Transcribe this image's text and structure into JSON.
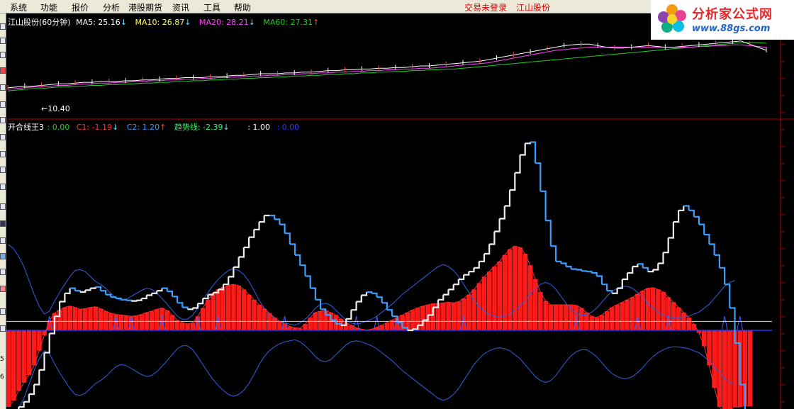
{
  "menu": [
    "系统",
    "功能",
    "报价",
    "分析",
    "港股期货",
    "资讯",
    "工具",
    "帮助"
  ],
  "status": {
    "login": "交易未登录",
    "stock": "江山股份"
  },
  "logo": {
    "brand": "分析家公式网",
    "url": "www.88gs.com"
  },
  "colors": {
    "ma5": "#ffffff",
    "ma10": "#ffff66",
    "ma20": "#ff44ff",
    "ma60": "#22cc22",
    "c1": "#ff2222",
    "c2": "#2f9bff",
    "trend": "#22ff66",
    "blue": "#2244ff",
    "thin_blue": "#3060e0"
  },
  "price_panel": {
    "title": "江山股份(60分钟)",
    "ma": [
      {
        "label": "MA5: 25.16",
        "arrow": "↓",
        "arrow_color": "#66ddff"
      },
      {
        "label": "MA10: 26.87",
        "arrow": "↓",
        "arrow_color": "#66ddff"
      },
      {
        "label": "MA20: 28.21",
        "arrow": "↓",
        "arrow_color": "#66ddff"
      },
      {
        "label": "MA60: 27.31",
        "arrow": "↑",
        "arrow_color": "#ff4444"
      }
    ],
    "low_label": "←10.40"
  },
  "indicator_panel": {
    "title": "开合线王3",
    "items": [
      {
        "label": ": 0.00",
        "arrow": ""
      },
      {
        "label": "C1: -1.19",
        "arrow": "↓"
      },
      {
        "label": "C2: 1.20",
        "arrow": "↑"
      },
      {
        "label": "趋势线: -2.39",
        "arrow": "↓"
      },
      {
        "label": ": 1.00",
        "arrow": ""
      },
      {
        "label": ": 0.00",
        "arrow": ""
      }
    ]
  },
  "left_axis": [
    "5",
    "6"
  ],
  "chart_data": {
    "type": "line",
    "trend_line": [
      -1.35,
      -1.28,
      -1.2,
      -1.12,
      -1.0,
      -0.85,
      -0.62,
      -0.35,
      -0.05,
      0.22,
      0.45,
      0.58,
      0.66,
      0.62,
      0.6,
      0.63,
      0.66,
      0.68,
      0.62,
      0.56,
      0.52,
      0.5,
      0.48,
      0.47,
      0.46,
      0.47,
      0.5,
      0.55,
      0.58,
      0.62,
      0.66,
      0.61,
      0.53,
      0.43,
      0.36,
      0.33,
      0.35,
      0.42,
      0.5,
      0.56,
      0.59,
      0.64,
      0.72,
      0.84,
      0.99,
      1.15,
      1.3,
      1.46,
      1.58,
      1.7,
      1.8,
      1.8,
      1.74,
      1.66,
      1.52,
      1.35,
      1.18,
      1.02,
      0.85,
      0.66,
      0.48,
      0.33,
      0.24,
      0.16,
      0.1,
      0.08,
      0.18,
      0.32,
      0.45,
      0.55,
      0.6,
      0.58,
      0.52,
      0.43,
      0.32,
      0.22,
      0.12,
      0.04,
      0.0,
      0.02,
      0.08,
      0.16,
      0.24,
      0.36,
      0.48,
      0.56,
      0.64,
      0.72,
      0.8,
      0.87,
      0.92,
      0.98,
      1.08,
      1.2,
      1.35,
      1.55,
      1.75,
      1.95,
      2.2,
      2.47,
      2.75,
      2.93,
      2.95,
      2.62,
      2.18,
      1.72,
      1.32,
      1.08,
      1.05,
      1.0,
      0.96,
      0.95,
      0.93,
      0.92,
      0.9,
      0.85,
      0.72,
      0.62,
      0.58,
      0.66,
      0.8,
      0.9,
      1.0,
      1.04,
      0.98,
      0.92,
      0.95,
      1.05,
      1.22,
      1.45,
      1.7,
      1.88,
      1.95,
      1.88,
      1.78,
      1.66,
      1.5,
      1.35,
      1.18,
      0.98,
      0.72,
      0.35,
      -0.2,
      -0.85,
      -1.35,
      -1.52,
      -1.5,
      -1.48,
      -1.45,
      -1.45
    ],
    "c1_histogram": [
      -1.2,
      -1.1,
      -0.95,
      -0.82,
      -0.7,
      -0.55,
      -0.32,
      -0.08,
      0.15,
      0.27,
      0.32,
      0.36,
      0.38,
      0.36,
      0.33,
      0.34,
      0.36,
      0.37,
      0.34,
      0.3,
      0.27,
      0.25,
      0.24,
      0.23,
      0.22,
      0.23,
      0.25,
      0.28,
      0.3,
      0.33,
      0.35,
      0.31,
      0.24,
      0.16,
      0.12,
      0.1,
      0.12,
      0.22,
      0.35,
      0.48,
      0.58,
      0.64,
      0.68,
      0.7,
      0.72,
      0.7,
      0.64,
      0.56,
      0.48,
      0.4,
      0.34,
      0.27,
      0.2,
      0.14,
      0.1,
      0.06,
      0.04,
      0.03,
      0.1,
      0.2,
      0.28,
      0.3,
      0.31,
      0.28,
      0.24,
      0.18,
      0.12,
      0.08,
      0.04,
      0.02,
      0.0,
      0.02,
      0.05,
      0.08,
      0.12,
      0.16,
      0.2,
      0.24,
      0.28,
      0.32,
      0.35,
      0.38,
      0.4,
      0.42,
      0.42,
      0.43,
      0.44,
      0.43,
      0.45,
      0.5,
      0.56,
      0.64,
      0.74,
      0.84,
      0.92,
      1.0,
      1.08,
      1.18,
      1.27,
      1.32,
      1.3,
      1.2,
      1.02,
      0.8,
      0.6,
      0.46,
      0.4,
      0.4,
      0.4,
      0.4,
      0.4,
      0.39,
      0.35,
      0.28,
      0.22,
      0.2,
      0.24,
      0.3,
      0.36,
      0.4,
      0.44,
      0.48,
      0.52,
      0.57,
      0.62,
      0.66,
      0.67,
      0.64,
      0.6,
      0.52,
      0.44,
      0.36,
      0.28,
      0.2,
      0.1,
      -0.04,
      -0.25,
      -0.55,
      -0.9,
      -1.2,
      -1.3,
      -1.25,
      -1.2,
      -1.2,
      -1.18,
      -1.19
    ],
    "c1_line": [
      -1.2,
      -1.1,
      -0.95,
      -0.82,
      -0.7,
      -0.55,
      -0.32,
      -0.08,
      0.15,
      0.27,
      0.32,
      0.36,
      0.38,
      0.36,
      0.33,
      0.34,
      0.36,
      0.37,
      0.34,
      0.3,
      0.27,
      0.25,
      0.24,
      0.23,
      0.22,
      0.23,
      0.25,
      0.28,
      0.3,
      0.33,
      0.35,
      0.31,
      0.24,
      0.16,
      0.12,
      0.1,
      0.12,
      0.22,
      0.35,
      0.48,
      0.58,
      0.64,
      0.68,
      0.7,
      0.72,
      0.7,
      0.64,
      0.56,
      0.48,
      0.4,
      0.34,
      0.27,
      0.2,
      0.14,
      0.1,
      0.06,
      0.04,
      0.03,
      0.1,
      0.2,
      0.28,
      0.3,
      0.31,
      0.28,
      0.24,
      0.18,
      0.12,
      0.08,
      0.04,
      0.02,
      0.0,
      0.02,
      0.05,
      0.08,
      0.12,
      0.16,
      0.2,
      0.24,
      0.28,
      0.32,
      0.35,
      0.38,
      0.4,
      0.42,
      0.42,
      0.43,
      0.44,
      0.43,
      0.45,
      0.5,
      0.56,
      0.64,
      0.74,
      0.84,
      0.92,
      1.0,
      1.08,
      1.18,
      1.27,
      1.32,
      1.3,
      1.2,
      1.02,
      0.8,
      0.6,
      0.46,
      0.4,
      0.4,
      0.4,
      0.4,
      0.4,
      0.39,
      0.35,
      0.28,
      0.22,
      0.2,
      0.24,
      0.3,
      0.36,
      0.4,
      0.44,
      0.48,
      0.52,
      0.57,
      0.62,
      0.66,
      0.67,
      0.64,
      0.6,
      0.52,
      0.44,
      0.36,
      0.28,
      0.2,
      0.1,
      -0.04,
      -0.25,
      -0.55,
      -0.9,
      -1.2,
      -1.3,
      -1.25,
      -1.2,
      -1.2,
      -1.18,
      -1.19
    ],
    "blue_upper": [
      0.82,
      0.78,
      0.7,
      0.6,
      0.46,
      0.32,
      0.2,
      0.12,
      0.15,
      0.25,
      0.34,
      0.42,
      0.5,
      0.56,
      0.57,
      0.55,
      0.5,
      0.45,
      0.42,
      0.38,
      0.33,
      0.28,
      0.26,
      0.27,
      0.3,
      0.33,
      0.36,
      0.38,
      0.37,
      0.33,
      0.28,
      0.22,
      0.16,
      0.1,
      0.07,
      0.07,
      0.11,
      0.18,
      0.26,
      0.34,
      0.41,
      0.47,
      0.52,
      0.56,
      0.58,
      0.56,
      0.52,
      0.45,
      0.36,
      0.26,
      0.18,
      0.12,
      0.08,
      0.05,
      0.03,
      0.02,
      0.01,
      0.03,
      0.07,
      0.12,
      0.18,
      0.22,
      0.23,
      0.21,
      0.16,
      0.11,
      0.06,
      0.03,
      0.02,
      0.03,
      0.05,
      0.07,
      0.1,
      0.14,
      0.18,
      0.22,
      0.27,
      0.32,
      0.36,
      0.4,
      0.44,
      0.48,
      0.52,
      0.56,
      0.6,
      0.62,
      0.6,
      0.56,
      0.5,
      0.42,
      0.34,
      0.26,
      0.2,
      0.15,
      0.12,
      0.1,
      0.09,
      0.1,
      0.12,
      0.16,
      0.2,
      0.26,
      0.32,
      0.38,
      0.42,
      0.44,
      0.42,
      0.37,
      0.3,
      0.23,
      0.17,
      0.13,
      0.11,
      0.11,
      0.14,
      0.18,
      0.24,
      0.3,
      0.35,
      0.38,
      0.4,
      0.4,
      0.38,
      0.34,
      0.29,
      0.23,
      0.18,
      0.14,
      0.11,
      0.09,
      0.08,
      0.08,
      0.09,
      0.1,
      0.12,
      0.14,
      0.18,
      0.22,
      0.28,
      0.34,
      0.4,
      0.44,
      0.46
    ],
    "blue_lower": [
      -0.82,
      -0.78,
      -0.7,
      -0.6,
      -0.46,
      -0.32,
      -0.2,
      -0.12,
      -0.15,
      -0.25,
      -0.34,
      -0.42,
      -0.5,
      -0.56,
      -0.57,
      -0.55,
      -0.5,
      -0.45,
      -0.42,
      -0.38,
      -0.33,
      -0.28,
      -0.26,
      -0.27,
      -0.3,
      -0.33,
      -0.36,
      -0.38,
      -0.37,
      -0.33,
      -0.28,
      -0.22,
      -0.16,
      -0.1,
      -0.07,
      -0.07,
      -0.11,
      -0.18,
      -0.26,
      -0.34,
      -0.41,
      -0.47,
      -0.52,
      -0.56,
      -0.58,
      -0.56,
      -0.52,
      -0.45,
      -0.36,
      -0.26,
      -0.18,
      -0.12,
      -0.08,
      -0.05,
      -0.03,
      -0.02,
      -0.01,
      -0.03,
      -0.07,
      -0.12,
      -0.18,
      -0.22,
      -0.23,
      -0.21,
      -0.16,
      -0.11,
      -0.06,
      -0.03,
      -0.02,
      -0.03,
      -0.05,
      -0.07,
      -0.1,
      -0.14,
      -0.18,
      -0.22,
      -0.27,
      -0.32,
      -0.36,
      -0.4,
      -0.44,
      -0.48,
      -0.52,
      -0.56,
      -0.6,
      -0.62,
      -0.6,
      -0.56,
      -0.5,
      -0.42,
      -0.34,
      -0.26,
      -0.2,
      -0.15,
      -0.12,
      -0.1,
      -0.09,
      -0.1,
      -0.12,
      -0.16,
      -0.2,
      -0.26,
      -0.32,
      -0.38,
      -0.42,
      -0.44,
      -0.42,
      -0.37,
      -0.3,
      -0.23,
      -0.17,
      -0.13,
      -0.11,
      -0.11,
      -0.14,
      -0.18,
      -0.24,
      -0.3,
      -0.35,
      -0.38,
      -0.4,
      -0.4,
      -0.38,
      -0.34,
      -0.29,
      -0.23,
      -0.18,
      -0.14,
      -0.11,
      -0.09,
      -0.08,
      -0.08,
      -0.09,
      -0.1,
      -0.12,
      -0.14,
      -0.18,
      -0.22,
      -0.28,
      -0.34,
      -0.4,
      -0.44,
      -0.46
    ],
    "signal_spikes": [
      8,
      21,
      24,
      30,
      37,
      41,
      54,
      68,
      72,
      76,
      89,
      111,
      123,
      129,
      140,
      143
    ],
    "hline_white": 0.14,
    "hline_blue": 0.0,
    "ma5_line": [
      0.32,
      0.33,
      0.34,
      0.34,
      0.35,
      0.36,
      0.37,
      0.37,
      0.38,
      0.39,
      0.39,
      0.4,
      0.4,
      0.4,
      0.41,
      0.41,
      0.42,
      0.42,
      0.43,
      0.44,
      0.44,
      0.45,
      0.45,
      0.45,
      0.46,
      0.46,
      0.47,
      0.48,
      0.48,
      0.49,
      0.5,
      0.5,
      0.5,
      0.51,
      0.51,
      0.52,
      0.52,
      0.53,
      0.54,
      0.54,
      0.55,
      0.55,
      0.56,
      0.56,
      0.57,
      0.57,
      0.58,
      0.58,
      0.59,
      0.6,
      0.6,
      0.61,
      0.62,
      0.63,
      0.64,
      0.65,
      0.66,
      0.68,
      0.7,
      0.72,
      0.74,
      0.76,
      0.78,
      0.8,
      0.82,
      0.84,
      0.86,
      0.87,
      0.88,
      0.88,
      0.86,
      0.84,
      0.83,
      0.83,
      0.84,
      0.85,
      0.86,
      0.85,
      0.84,
      0.84,
      0.85,
      0.86,
      0.87,
      0.88,
      0.89,
      0.9,
      0.91,
      0.92,
      0.88,
      0.84,
      0.8
    ],
    "ma20_line": [
      0.3,
      0.31,
      0.32,
      0.33,
      0.33,
      0.34,
      0.35,
      0.35,
      0.36,
      0.37,
      0.37,
      0.38,
      0.38,
      0.39,
      0.39,
      0.4,
      0.4,
      0.41,
      0.41,
      0.42,
      0.42,
      0.43,
      0.43,
      0.44,
      0.44,
      0.45,
      0.45,
      0.46,
      0.46,
      0.47,
      0.47,
      0.48,
      0.48,
      0.49,
      0.49,
      0.5,
      0.5,
      0.51,
      0.51,
      0.52,
      0.52,
      0.53,
      0.53,
      0.54,
      0.54,
      0.55,
      0.55,
      0.56,
      0.56,
      0.57,
      0.57,
      0.58,
      0.59,
      0.6,
      0.61,
      0.62,
      0.63,
      0.64,
      0.66,
      0.68,
      0.7,
      0.72,
      0.74,
      0.76,
      0.78,
      0.8,
      0.81,
      0.82,
      0.83,
      0.84,
      0.84,
      0.84,
      0.84,
      0.84,
      0.84,
      0.84,
      0.84,
      0.84,
      0.84,
      0.84,
      0.84,
      0.84,
      0.85,
      0.85,
      0.86,
      0.86,
      0.87,
      0.87,
      0.86,
      0.85,
      0.84
    ],
    "ma60_line": [
      0.28,
      0.29,
      0.3,
      0.31,
      0.31,
      0.32,
      0.33,
      0.33,
      0.34,
      0.34,
      0.35,
      0.35,
      0.36,
      0.36,
      0.37,
      0.37,
      0.38,
      0.38,
      0.39,
      0.39,
      0.4,
      0.4,
      0.41,
      0.41,
      0.42,
      0.42,
      0.43,
      0.43,
      0.44,
      0.44,
      0.45,
      0.45,
      0.46,
      0.46,
      0.47,
      0.47,
      0.48,
      0.48,
      0.49,
      0.49,
      0.5,
      0.5,
      0.51,
      0.51,
      0.52,
      0.52,
      0.53,
      0.53,
      0.54,
      0.54,
      0.55,
      0.55,
      0.56,
      0.56,
      0.57,
      0.58,
      0.59,
      0.6,
      0.61,
      0.62,
      0.63,
      0.64,
      0.65,
      0.66,
      0.67,
      0.68,
      0.69,
      0.7,
      0.71,
      0.72,
      0.73,
      0.74,
      0.75,
      0.76,
      0.77,
      0.78,
      0.79,
      0.8,
      0.81,
      0.82,
      0.83,
      0.84,
      0.85,
      0.86,
      0.87,
      0.88,
      0.89,
      0.9,
      0.9,
      0.9,
      0.89
    ]
  }
}
